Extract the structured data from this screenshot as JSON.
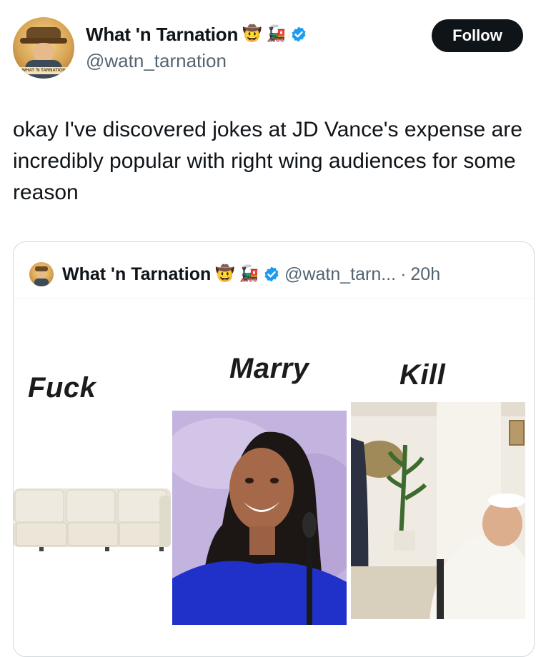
{
  "author": {
    "display_name": "What 'n Tarnation",
    "emojis": [
      "🤠",
      "🚂"
    ],
    "handle": "@watn_tarnation",
    "verified": true,
    "avatar_banner_text": "WHAT 'N TARNATION"
  },
  "follow_button": {
    "label": "Follow"
  },
  "tweet": {
    "text": "okay I've discovered jokes at JD Vance's expense are incredibly popular with right wing audiences for some reason"
  },
  "quoted_tweet": {
    "display_name": "What 'n Tarnation",
    "emojis": [
      "🤠",
      "🚂"
    ],
    "handle": "@watn_tarn...",
    "separator": "·",
    "time": "20h",
    "verified": true,
    "meme": {
      "labels": [
        "Fuck",
        "Marry",
        "Kill"
      ]
    }
  },
  "colors": {
    "text_primary": "#0f1419",
    "text_secondary": "#536471",
    "verified_blue": "#1d9bf0",
    "follow_bg": "#0f1419",
    "border": "#cfd9de"
  }
}
